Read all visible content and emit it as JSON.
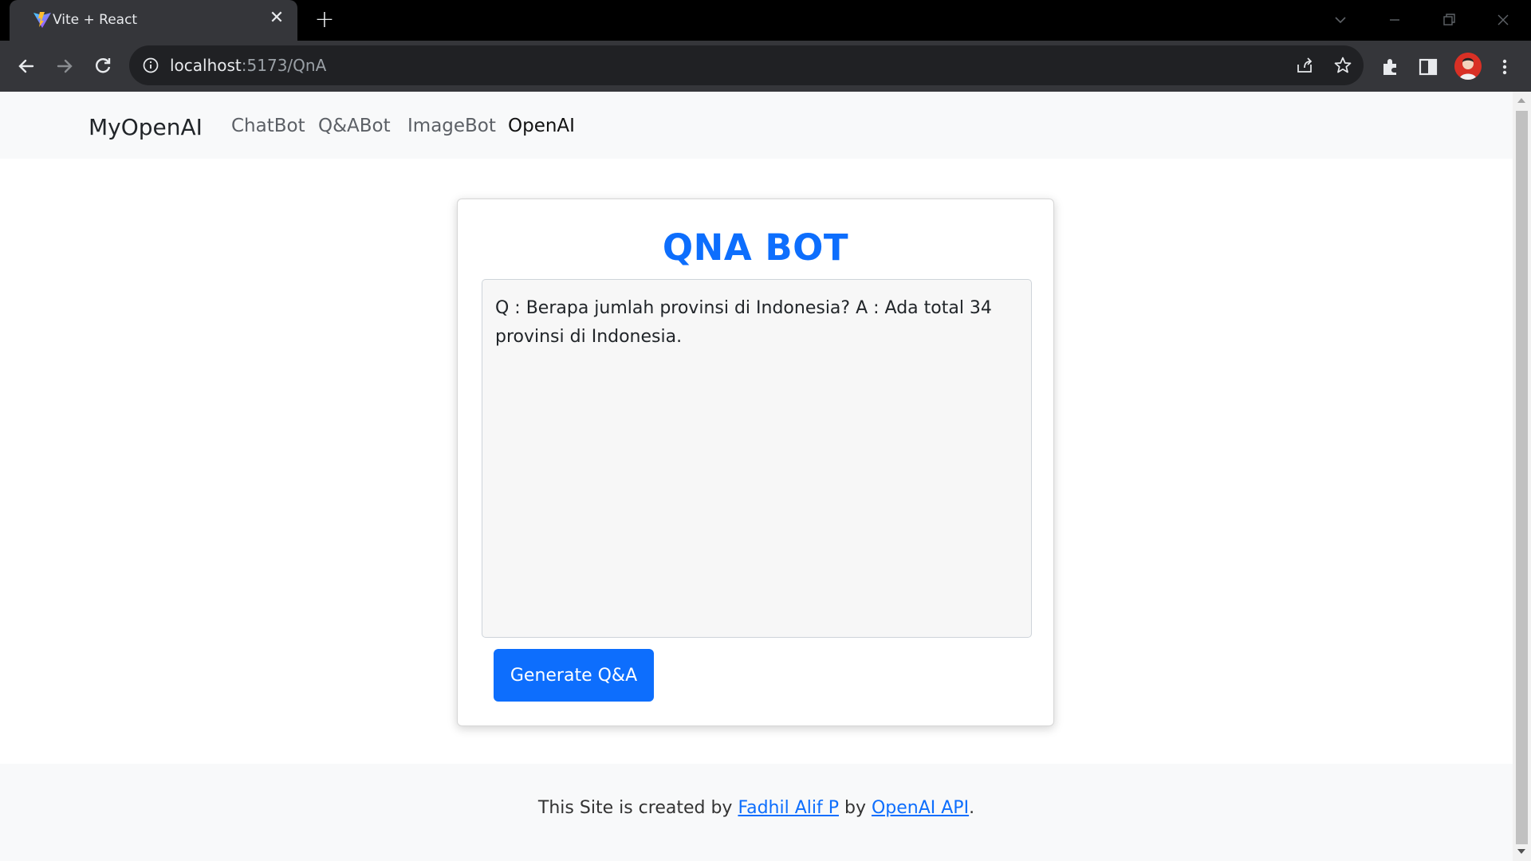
{
  "browser": {
    "tab_title": "Vite + React",
    "url_host": "localhost",
    "url_path": ":5173/QnA"
  },
  "navbar": {
    "brand": "MyOpenAI",
    "links": [
      "ChatBot",
      "Q&ABot",
      "ImageBot",
      "OpenAI"
    ],
    "active": "OpenAI"
  },
  "card": {
    "title": "QNA BOT",
    "answer": "Q : Berapa jumlah provinsi di Indonesia? A : Ada total 34 provinsi di Indonesia.",
    "button_label": "Generate Q&A"
  },
  "footer": {
    "prefix": "This Site is created by ",
    "author_link": "Fadhil Alif P",
    "middle": " by ",
    "api_link": "OpenAI API",
    "suffix": "."
  },
  "colors": {
    "accent": "#0d6efd",
    "chrome_dark": "#35363a"
  },
  "icons": [
    "vite-favicon",
    "close-icon",
    "plus-icon",
    "back-icon",
    "forward-icon",
    "reload-icon",
    "info-icon",
    "share-icon",
    "star-icon",
    "extensions-icon",
    "sidepanel-icon",
    "avatar",
    "more-icon"
  ]
}
